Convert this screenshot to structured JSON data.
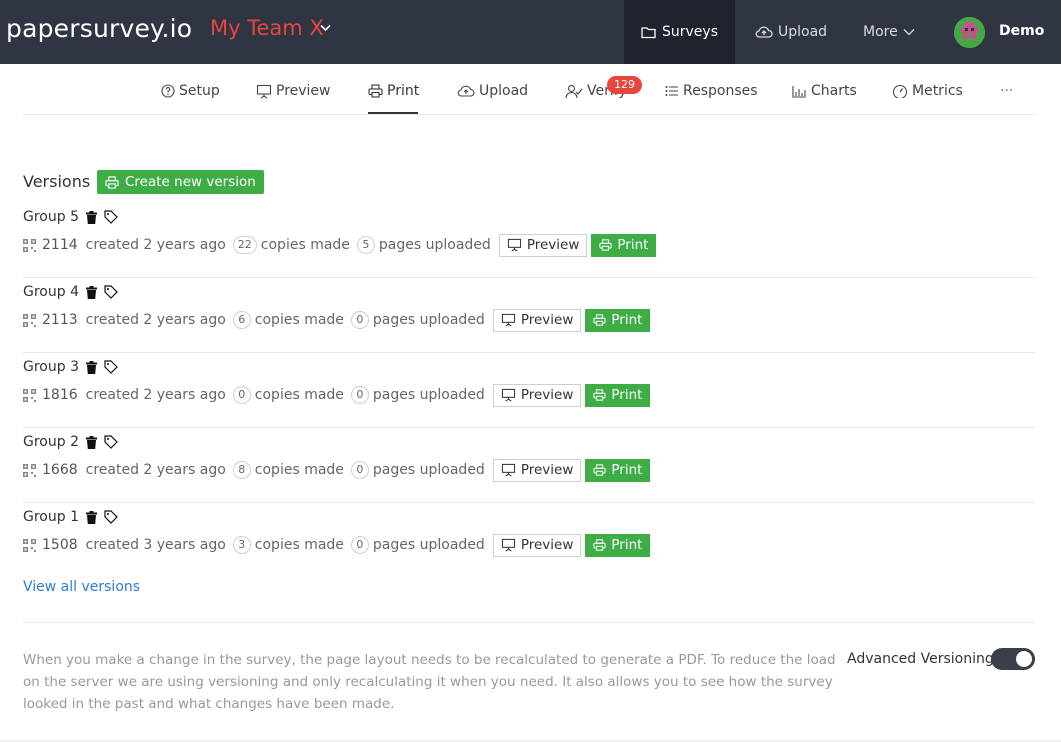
{
  "header": {
    "logo": "papersurvey.io",
    "team": "My Team X",
    "nav": {
      "surveys": "Surveys",
      "upload": "Upload",
      "more": "More"
    },
    "user": "Demo"
  },
  "tabs": {
    "setup": "Setup",
    "preview": "Preview",
    "print": "Print",
    "upload": "Upload",
    "verify": "Verify",
    "verify_badge": "129",
    "responses": "Responses",
    "charts": "Charts",
    "metrics": "Metrics",
    "more": "···"
  },
  "versions": {
    "title": "Versions",
    "create_label": "Create new version",
    "groups": [
      {
        "name": "Group 5",
        "id": "2114",
        "created": "created 2 years ago",
        "copies": "22",
        "copies_label": "copies made",
        "pages": "5",
        "pages_label": "pages uploaded",
        "preview_label": "Preview",
        "print_label": "Print"
      },
      {
        "name": "Group 4",
        "id": "2113",
        "created": "created 2 years ago",
        "copies": "6",
        "copies_label": "copies made",
        "pages": "0",
        "pages_label": "pages uploaded",
        "preview_label": "Preview",
        "print_label": "Print"
      },
      {
        "name": "Group 3",
        "id": "1816",
        "created": "created 2 years ago",
        "copies": "0",
        "copies_label": "copies made",
        "pages": "0",
        "pages_label": "pages uploaded",
        "preview_label": "Preview",
        "print_label": "Print"
      },
      {
        "name": "Group 2",
        "id": "1668",
        "created": "created 2 years ago",
        "copies": "8",
        "copies_label": "copies made",
        "pages": "0",
        "pages_label": "pages uploaded",
        "preview_label": "Preview",
        "print_label": "Print"
      },
      {
        "name": "Group 1",
        "id": "1508",
        "created": "created 3 years ago",
        "copies": "3",
        "copies_label": "copies made",
        "pages": "0",
        "pages_label": "pages uploaded",
        "preview_label": "Preview",
        "print_label": "Print"
      }
    ],
    "view_all": "View all versions"
  },
  "footer": {
    "description": "When you make a change in the survey, the page layout needs to be recalculated to generate a PDF. To reduce the load on the server we are using versioning and only recalculating it when you need. It also allows you to see how the survey looked in the past and what changes have been made.",
    "advanced_label": "Advanced Versioning",
    "advanced_on": true
  },
  "colors": {
    "topbar": "#2f3542",
    "team": "#e8453c",
    "green": "#3fad46",
    "link": "#2b7cd3"
  }
}
